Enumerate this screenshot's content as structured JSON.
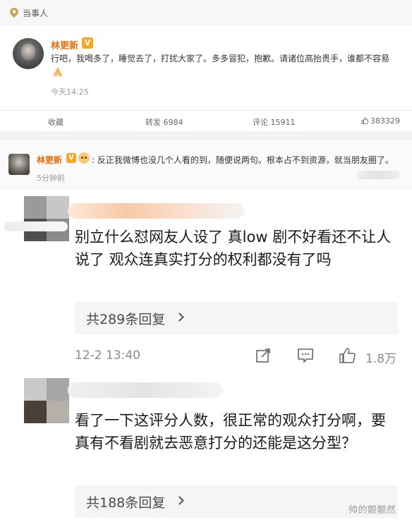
{
  "header": {
    "tag": "当事人"
  },
  "post": {
    "author": "林更新",
    "verified_badge": "V",
    "text": "行吧，我喝多了，睡觉去了，打扰大家了。多多冒犯，抱歉。请诸位高抬贵手，谁都不容易",
    "emoji_icon": "folded-hands-icon",
    "time": "今天14:25"
  },
  "actions": {
    "collect": "收藏",
    "repost": "转发 6984",
    "comment": "评论 15911",
    "like": "383329"
  },
  "reply": {
    "author": "林更新",
    "verified_badge": "V",
    "text": ": 反正我微博也没几个人看的到，随便说两句。根本占不到资源，就当朋友圈了。",
    "time": "5分钟前"
  },
  "comments": [
    {
      "text": "别立什么怼网友人设了 真low 剧不好看还不让人说了 观众连真实打分的权利都没有了吗",
      "replies": "共289条回复",
      "time": "12-2 13:40",
      "likes": "1.8万"
    },
    {
      "text": "看了一下这评分人数，很正常的观众打分啊，要真有不看剧就去恶意打分的还能是这分型？",
      "replies": "共188条回复"
    }
  ],
  "watermark": "帅的颤颤然",
  "colors": {
    "accent": "#e86b0c",
    "badge": "#f5a623"
  }
}
